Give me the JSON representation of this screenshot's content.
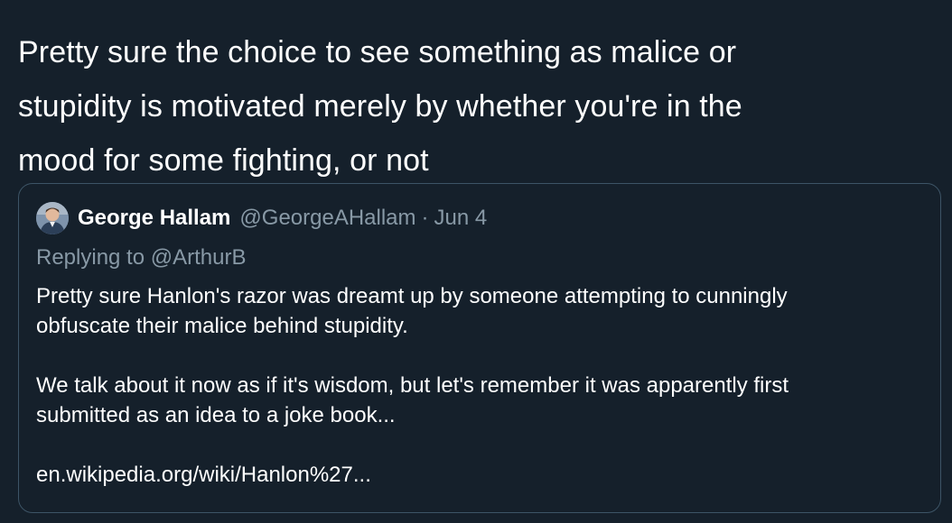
{
  "tweet": {
    "text_lines": [
      "Pretty sure the choice to see something as malice or",
      "stupidity is motivated merely by whether you're in the",
      "mood for some fighting, or not"
    ]
  },
  "quoted_tweet": {
    "author_name": "George Hallam",
    "author_handle": "@GeorgeAHallam",
    "separator": "·",
    "date": "Jun 4",
    "replying_to": "Replying to @ArthurB",
    "body_lines": [
      "Pretty sure Hanlon's razor was dreamt up by someone  attempting to cunningly",
      "obfuscate their malice behind stupidity.",
      "We talk about it now as if it's wisdom, but let's remember it was apparently first",
      "submitted as an idea to a joke book..."
    ],
    "link": "en.wikipedia.org/wiki/Hanlon%27..."
  },
  "colors": {
    "background": "#15202b",
    "text_primary": "#ffffff",
    "text_secondary": "#8899a6",
    "border": "#3d5466"
  },
  "icons": {
    "avatar": "avatar-photo"
  }
}
